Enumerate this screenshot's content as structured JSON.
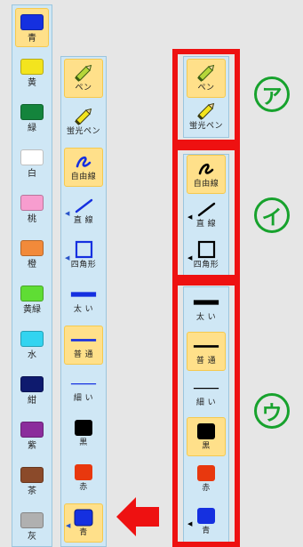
{
  "color_panel": {
    "items": [
      {
        "label": "青",
        "color": "#1530e0",
        "selected": true
      },
      {
        "label": "黄",
        "color": "#f3e41e",
        "selected": false
      },
      {
        "label": "緑",
        "color": "#14843c",
        "selected": false
      },
      {
        "label": "白",
        "color": "#ffffff",
        "selected": false
      },
      {
        "label": "桃",
        "color": "#f79dcf",
        "selected": false
      },
      {
        "label": "橙",
        "color": "#f28a3a",
        "selected": false
      },
      {
        "label": "黄緑",
        "color": "#5fdd34",
        "selected": false
      },
      {
        "label": "水",
        "color": "#32d4f0",
        "selected": false
      },
      {
        "label": "紺",
        "color": "#0e1a6e",
        "selected": false
      },
      {
        "label": "紫",
        "color": "#8b2c9c",
        "selected": false
      },
      {
        "label": "茶",
        "color": "#8b4a2a",
        "selected": false
      },
      {
        "label": "灰",
        "color": "#b0b0b0",
        "selected": false
      }
    ]
  },
  "tool_panel": {
    "items": [
      {
        "label": "ペン",
        "icon": "pencil-icon",
        "selected": true
      },
      {
        "label": "蛍光ペン",
        "icon": "highlighter-icon",
        "selected": false
      },
      {
        "label": "自由線",
        "icon": "freehand-icon",
        "selected": true
      },
      {
        "label": "直 線",
        "icon": "line-icon",
        "selected": false
      },
      {
        "label": "四角形",
        "icon": "rectangle-icon",
        "selected": false
      },
      {
        "label": "太 い",
        "icon": "thick-line-icon",
        "selected": false
      },
      {
        "label": "普 通",
        "icon": "normal-line-icon",
        "selected": true
      },
      {
        "label": "細 い",
        "icon": "thin-line-icon",
        "selected": false
      },
      {
        "label": "黒",
        "icon": "black-swatch-icon",
        "selected": false
      },
      {
        "label": "赤",
        "icon": "red-swatch-icon",
        "selected": false
      },
      {
        "label": "青",
        "icon": "blue-swatch-icon",
        "selected": true
      }
    ],
    "line_color": "#1530e0",
    "swatch_black": "#000000",
    "swatch_red": "#e8380e",
    "swatch_blue": "#1530e0"
  },
  "annotation": {
    "group_a": {
      "label": "ア",
      "items": [
        {
          "label": "ペン",
          "selected": true
        },
        {
          "label": "蛍光ペン",
          "selected": false
        }
      ]
    },
    "group_b": {
      "label": "イ",
      "items": [
        {
          "label": "自由線",
          "selected": true
        },
        {
          "label": "直 線",
          "selected": false
        },
        {
          "label": "四角形",
          "selected": false
        }
      ]
    },
    "group_c": {
      "label": "ウ",
      "items": [
        {
          "label": "太 い",
          "selected": false
        },
        {
          "label": "普 通",
          "selected": true
        },
        {
          "label": "細 い",
          "selected": false
        },
        {
          "label": "黒",
          "selected": true
        },
        {
          "label": "赤",
          "selected": false
        },
        {
          "label": "青",
          "selected": false
        }
      ]
    },
    "line_color": "#000000",
    "accent_red": "#ee1111",
    "accent_green": "#17a22d"
  }
}
